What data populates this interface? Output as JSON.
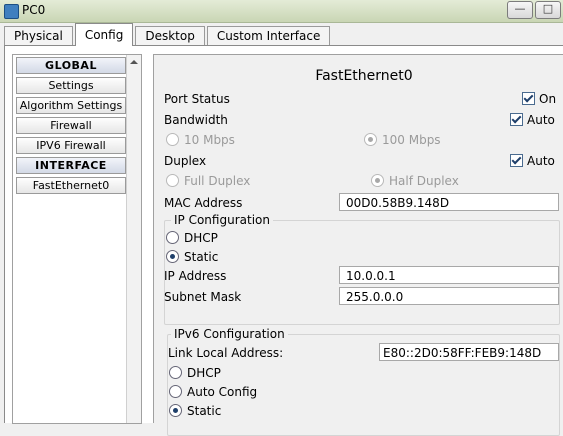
{
  "window": {
    "title": "PC0"
  },
  "tabs": [
    {
      "label": "Physical"
    },
    {
      "label": "Config"
    },
    {
      "label": "Desktop"
    },
    {
      "label": "Custom Interface"
    }
  ],
  "nav": [
    {
      "label": "GLOBAL"
    },
    {
      "label": "Settings"
    },
    {
      "label": "Algorithm Settings"
    },
    {
      "label": "Firewall"
    },
    {
      "label": "IPV6 Firewall"
    },
    {
      "label": "INTERFACE"
    },
    {
      "label": "FastEthernet0"
    }
  ],
  "pane": {
    "title": "FastEthernet0",
    "port_status": {
      "label": "Port Status",
      "check_label": "On",
      "checked": true
    },
    "bandwidth": {
      "label": "Bandwidth",
      "auto_label": "Auto",
      "auto_checked": true,
      "opt10": "10 Mbps",
      "opt100": "100 Mbps",
      "selected": "100 Mbps"
    },
    "duplex": {
      "label": "Duplex",
      "auto_label": "Auto",
      "auto_checked": true,
      "full": "Full Duplex",
      "half": "Half Duplex",
      "selected": "Half Duplex"
    },
    "mac": {
      "label": "MAC Address",
      "value": "00D0.58B9.148D"
    },
    "ip_config": {
      "title": "IP Configuration",
      "dhcp": "DHCP",
      "static": "Static",
      "selected": "Static",
      "ip_label": "IP Address",
      "ip_value": "10.0.0.1",
      "mask_label": "Subnet Mask",
      "mask_value": "255.0.0.0"
    },
    "ipv6_config": {
      "title": "IPv6 Configuration",
      "link_local_label": "Link Local Address:",
      "link_local_value": "E80::2D0:58FF:FEB9:148D",
      "dhcp": "DHCP",
      "auto_config": "Auto Config",
      "static": "Static",
      "selected": "Static"
    }
  }
}
